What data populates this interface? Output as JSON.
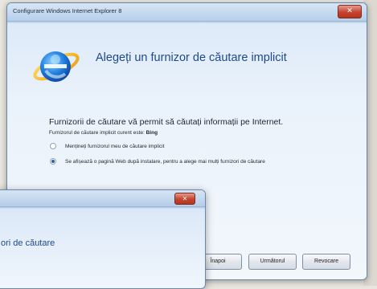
{
  "window": {
    "title": "Configurare Windows Internet Explorer 8",
    "close_glyph": "✕",
    "heading": "Alegeți un furnizor de căutare implicit",
    "intro": "Furnizorii de căutare vă permit să căutați informații pe Internet.",
    "current_label": "Furnizorul de căutare implicit curent este:",
    "current_value": "Bing",
    "options": [
      {
        "label": "Mențineți furnizorul meu de căutare implicit",
        "selected": false
      },
      {
        "label": "Se afișează o pagină Web după instalare, pentru a alege mai mulți furnizori de căutare",
        "selected": true
      }
    ],
    "buttons": {
      "back": "Înapoi",
      "next": "Următorul",
      "cancel": "Revocare"
    }
  },
  "back_window": {
    "close_glyph": "✕",
    "heading_fragment": "ori de căutare"
  },
  "icons": {
    "logo": "internet-explorer-logo"
  },
  "colors": {
    "heading": "#1f4a8a",
    "close": "#c4442f"
  }
}
